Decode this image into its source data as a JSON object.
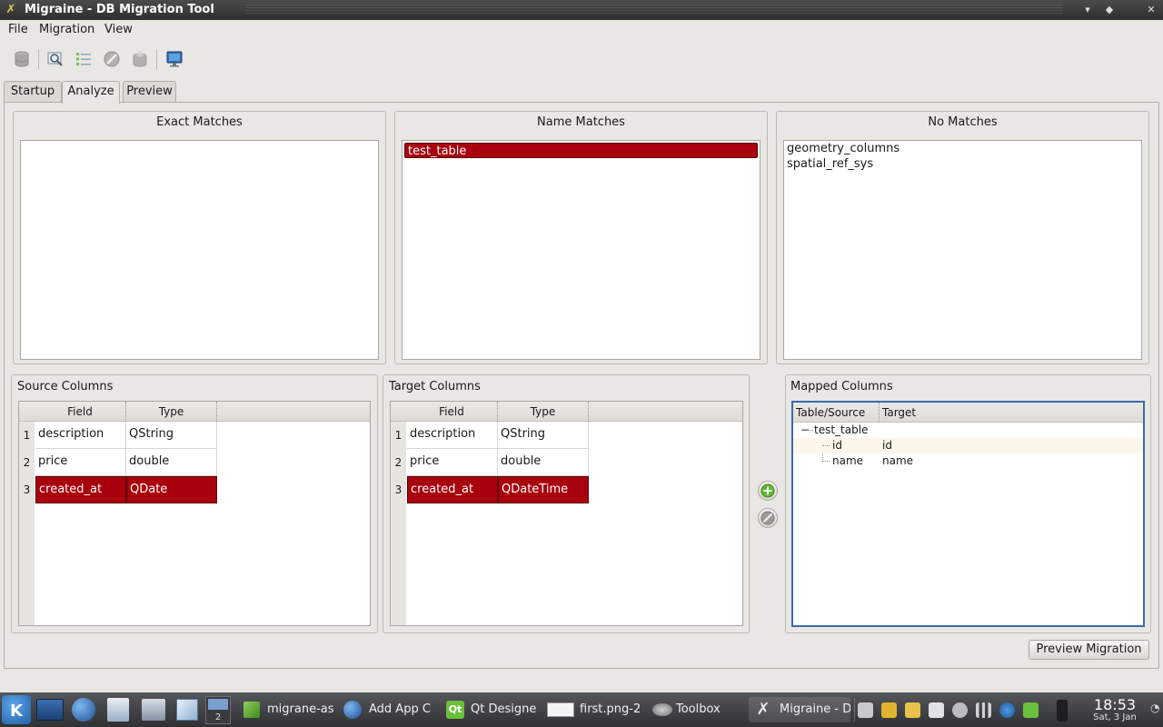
{
  "window": {
    "title": "Migraine - DB Migration Tool",
    "controls": [
      "▾",
      "◆",
      "✕"
    ]
  },
  "menubar": [
    {
      "label": "File",
      "mnemonic_index": 0
    },
    {
      "label": "Migration",
      "mnemonic_index": 0
    },
    {
      "label": "View",
      "mnemonic_index": 0
    }
  ],
  "toolbar": [
    {
      "name": "database-icon"
    },
    {
      "name": "magnifier-icon"
    },
    {
      "name": "list-icon"
    },
    {
      "name": "cancel-icon"
    },
    {
      "name": "upload-icon"
    },
    {
      "name": "monitor-icon"
    }
  ],
  "tabs": [
    "Startup",
    "Analyze",
    "Preview"
  ],
  "active_tab": "Analyze",
  "exact_matches": {
    "title": "Exact Matches",
    "items": []
  },
  "name_matches": {
    "title": "Name Matches",
    "items": [
      "test_table"
    ],
    "selected_index": 0
  },
  "no_matches": {
    "title": "No Matches",
    "items": [
      "geometry_columns",
      "spatial_ref_sys"
    ]
  },
  "source_columns": {
    "title": "Source Columns",
    "headers": [
      "Field",
      "Type"
    ],
    "rows": [
      {
        "num": "1",
        "field": "description",
        "type": "QString"
      },
      {
        "num": "2",
        "field": "price",
        "type": "double"
      },
      {
        "num": "3",
        "field": "created_at",
        "type": "QDate"
      }
    ],
    "selected_row": 2
  },
  "target_columns": {
    "title": "Target Columns",
    "headers": [
      "Field",
      "Type"
    ],
    "rows": [
      {
        "num": "1",
        "field": "description",
        "type": "QString"
      },
      {
        "num": "2",
        "field": "price",
        "type": "double"
      },
      {
        "num": "3",
        "field": "created_at",
        "type": "QDateTime"
      }
    ],
    "selected_row": 2
  },
  "mapped_columns": {
    "title": "Mapped Columns",
    "headers": [
      "Table/Source",
      "Target"
    ],
    "tree": {
      "table": "test_table",
      "expander": "−",
      "children": [
        {
          "source": "id",
          "target": "id"
        },
        {
          "source": "name",
          "target": "name"
        }
      ]
    }
  },
  "buttons": {
    "add_mapping": "+",
    "remove_mapping": "⊘",
    "preview_migration": "Preview Migration"
  },
  "taskbar": {
    "pager_label": "2",
    "tasks": [
      "migrane-as",
      "Add   App C",
      "Qt Designe",
      "first.png-2",
      "Toolbox",
      "Migraine - D"
    ],
    "active_task_index": 5,
    "clock": {
      "time": "18:53",
      "date": "Sat, 3 Jan"
    }
  },
  "colors": {
    "selection": "#a8000c",
    "window_bg": "#e9e7e3",
    "titlebar": "#3a3a3a",
    "taskbar": "#3f4043",
    "focus_border": "#3d6aa8"
  }
}
